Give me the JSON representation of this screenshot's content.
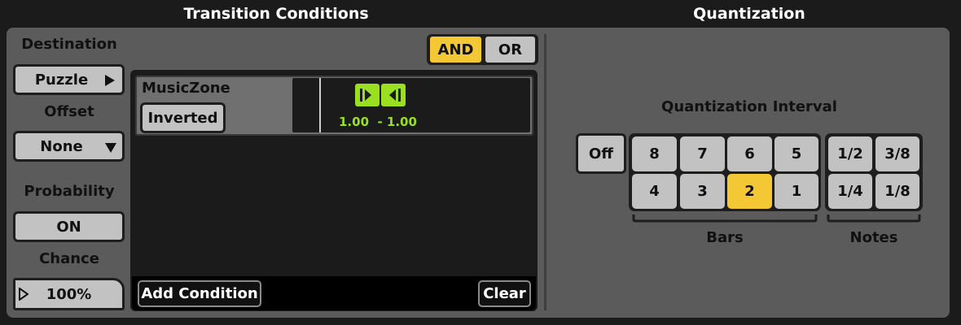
{
  "headers": {
    "transition_conditions": "Transition Conditions",
    "quantization": "Quantization"
  },
  "left": {
    "destination_label": "Destination",
    "destination_value": "Puzzle",
    "offset_label": "Offset",
    "offset_value": "None",
    "probability_label": "Probability",
    "probability_value": "ON",
    "chance_label": "Chance",
    "chance_value": "100%"
  },
  "logic": {
    "and_label": "AND",
    "or_label": "OR",
    "selected": "AND"
  },
  "conditions": [
    {
      "name": "MusicZone",
      "inverted_label": "Inverted",
      "range_text": "1.00  - 1.00"
    }
  ],
  "footer": {
    "add_condition": "Add Condition",
    "clear": "Clear"
  },
  "quantization": {
    "interval_label": "Quantization Interval",
    "off_label": "Off",
    "bars_row1": [
      "8",
      "7",
      "6",
      "5"
    ],
    "bars_row2": [
      "4",
      "3",
      "2",
      "1"
    ],
    "notes_row1": [
      "1/2",
      "3/8"
    ],
    "notes_row2": [
      "1/4",
      "1/8"
    ],
    "selected": "2",
    "bars_label": "Bars",
    "notes_label": "Notes"
  },
  "colors": {
    "accent": "#f3c834",
    "range_green": "#9ae020",
    "panel": "#5b5b5b"
  },
  "icons": {
    "destination_arrow": "triangle-right-icon",
    "offset_arrow": "triangle-down-icon",
    "chance_handle": "triangle-right-outline-icon",
    "range_handles": "bracket-handle-icons"
  }
}
